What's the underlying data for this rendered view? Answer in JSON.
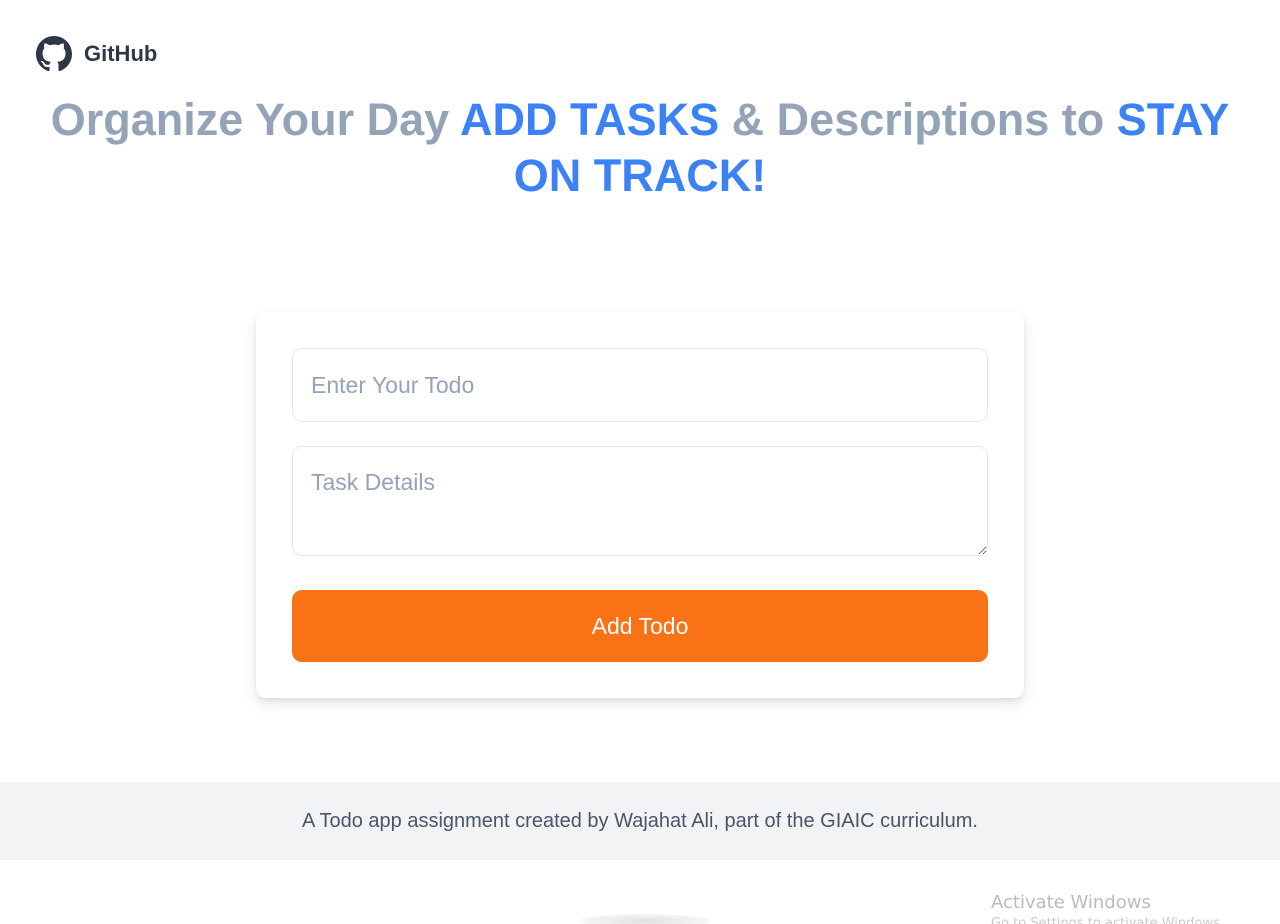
{
  "header": {
    "brand_label": "GitHub",
    "brand_icon": "github-icon"
  },
  "headline": {
    "part1": "Organize Your Day ",
    "accent1": "ADD TASKS",
    "part2": " & Descriptions to ",
    "accent2": "STAY ON TRACK!"
  },
  "form": {
    "todo_placeholder": "Enter Your Todo",
    "todo_value": "",
    "details_placeholder": "Task Details",
    "details_value": "",
    "submit_label": "Add Todo"
  },
  "footer": {
    "text": "A Todo app assignment created by Wajahat Ali, part of the GIAIC curriculum."
  },
  "watermark": {
    "title": "Activate Windows",
    "subtitle": "Go to Settings to activate Windows."
  },
  "colors": {
    "accent_blue": "#3b82f6",
    "headline_gray": "#94a3b8",
    "button_orange": "#f97316",
    "footer_bg": "#f1f3f5"
  }
}
